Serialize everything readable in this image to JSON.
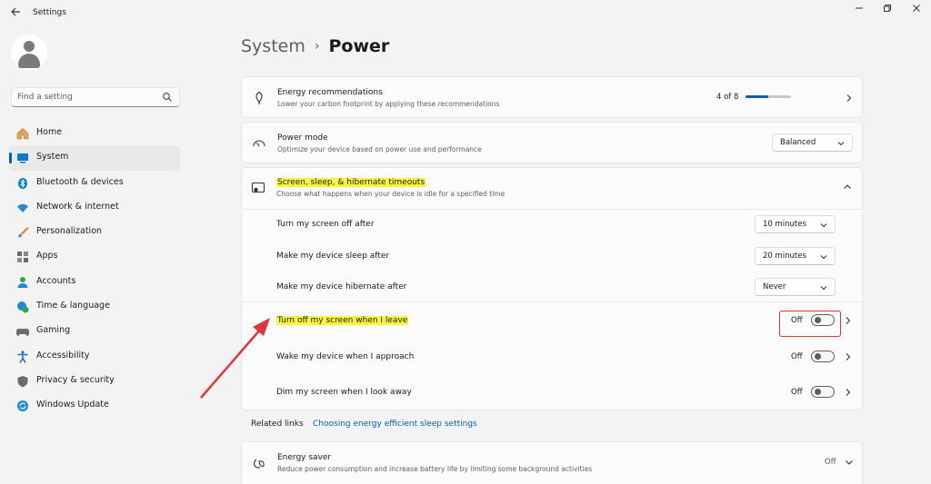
{
  "window": {
    "title": "Settings",
    "back_icon": "back-arrow-icon",
    "controls": [
      "minimize-icon",
      "maximize-icon",
      "close-icon"
    ]
  },
  "search": {
    "placeholder": "Find a setting",
    "icon": "search-icon"
  },
  "sidebar": {
    "items": [
      {
        "label": "Home",
        "icon": "home-icon",
        "color": "#e8a055"
      },
      {
        "label": "System",
        "icon": "system-icon",
        "color": "#0078d4",
        "active": true
      },
      {
        "label": "Bluetooth & devices",
        "icon": "bluetooth-icon",
        "color": "#0078d4"
      },
      {
        "label": "Network & internet",
        "icon": "wifi-icon",
        "color": "#1f8ad9"
      },
      {
        "label": "Personalization",
        "icon": "brush-icon",
        "color": "#e87a3a"
      },
      {
        "label": "Apps",
        "icon": "apps-icon",
        "color": "#6b6b6b"
      },
      {
        "label": "Accounts",
        "icon": "accounts-icon",
        "color": "#2ea44f"
      },
      {
        "label": "Time & language",
        "icon": "globe-clock-icon",
        "color": "#1f8ad9"
      },
      {
        "label": "Gaming",
        "icon": "gamepad-icon",
        "color": "#6b6b6b"
      },
      {
        "label": "Accessibility",
        "icon": "accessibility-icon",
        "color": "#1f6fc5"
      },
      {
        "label": "Privacy & security",
        "icon": "shield-icon",
        "color": "#6b6b6b"
      },
      {
        "label": "Windows Update",
        "icon": "update-icon",
        "color": "#1f8ad9"
      }
    ]
  },
  "breadcrumb": {
    "parent": "System",
    "separator": "›",
    "current": "Power"
  },
  "energy_recommendations": {
    "title": "Energy recommendations",
    "subtitle": "Lower your carbon footprint by applying these recommendations",
    "count": "4 of 8",
    "progress": 0.5
  },
  "power_mode": {
    "title": "Power mode",
    "subtitle": "Optimize your device based on power use and performance",
    "value": "Balanced"
  },
  "timeouts": {
    "title": "Screen, sleep, & hibernate timeouts",
    "subtitle": "Choose what happens when your device is idle for a specified time",
    "rows": [
      {
        "label": "Turn my screen off after",
        "value": "10 minutes"
      },
      {
        "label": "Make my device sleep after",
        "value": "20 minutes"
      },
      {
        "label": "Make my device hibernate after",
        "value": "Never"
      }
    ]
  },
  "presence": {
    "rows": [
      {
        "label": "Turn off my screen when I leave",
        "state": "Off"
      },
      {
        "label": "Wake my device when I approach",
        "state": "Off"
      },
      {
        "label": "Dim my screen when I look away",
        "state": "Off"
      }
    ]
  },
  "related_links": {
    "label": "Related links",
    "link": "Choosing energy efficient sleep settings"
  },
  "energy_saver": {
    "title": "Energy saver",
    "subtitle": "Reduce power consumption and increase battery life by limiting some background activities",
    "state": "Off"
  },
  "colors": {
    "accent": "#005fb8",
    "highlight": "#f7f73a",
    "annotation": "#e5333b"
  }
}
